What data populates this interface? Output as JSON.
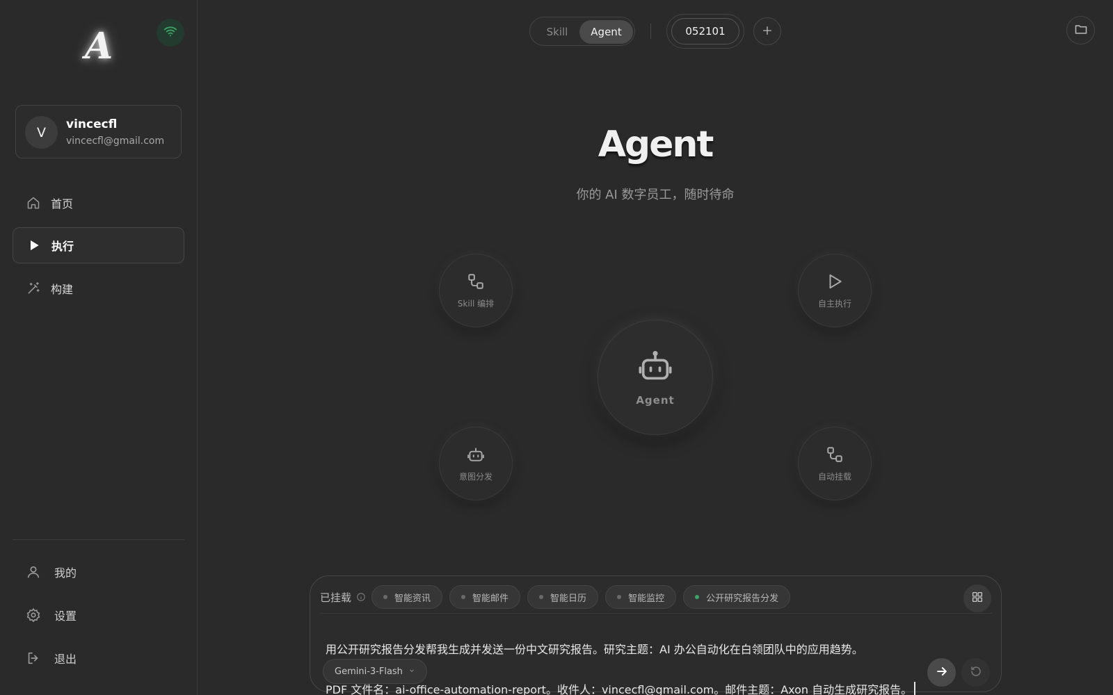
{
  "sidebar": {
    "logo_letter": "A",
    "user": {
      "initial": "V",
      "name": "vincecfl",
      "email": "vincecfl@gmail.com"
    },
    "nav": [
      {
        "label": "首页",
        "icon": "home-icon"
      },
      {
        "label": "执行",
        "icon": "play-icon",
        "active": true
      },
      {
        "label": "构建",
        "icon": "magic-wand-icon"
      }
    ],
    "bottom": [
      {
        "label": "我的",
        "icon": "user-icon"
      },
      {
        "label": "设置",
        "icon": "gear-icon"
      },
      {
        "label": "退出",
        "icon": "logout-icon"
      }
    ]
  },
  "topbar": {
    "mode_options": [
      "Skill",
      "Agent"
    ],
    "selected_mode": "Agent",
    "session_id": "052101",
    "add_label": "+"
  },
  "hero": {
    "title": "Agent",
    "subtitle": "你的 AI 数字员工，随时待命"
  },
  "diagram": {
    "center_label": "Agent",
    "nodes": [
      {
        "label": "Skill 编排",
        "icon": "skill-flow-icon"
      },
      {
        "label": "自主执行",
        "icon": "play-icon"
      },
      {
        "label": "意图分发",
        "icon": "robot-icon"
      },
      {
        "label": "自动挂载",
        "icon": "skill-flow-icon"
      }
    ]
  },
  "composer": {
    "mounted_label": "已挂载",
    "chips": [
      {
        "label": "智能资讯",
        "active": false
      },
      {
        "label": "智能邮件",
        "active": false
      },
      {
        "label": "智能日历",
        "active": false
      },
      {
        "label": "智能监控",
        "active": false
      },
      {
        "label": "公开研究报告分发",
        "active": true
      }
    ],
    "prompt_line1": "用公开研究报告分发帮我生成并发送一份中文研究报告。研究主题：AI 办公自动化在白领团队中的应用趋势。",
    "prompt_line2": "PDF 文件名：ai-office-automation-report。收件人：vincecfl@gmail.com。邮件主题：Axon 自动生成研究报告。",
    "model": "Gemini-3-Flash"
  },
  "colors": {
    "background": "#2a2a2a",
    "wifi_green": "#3aa565",
    "chip_active_dot": "#3aa565"
  }
}
